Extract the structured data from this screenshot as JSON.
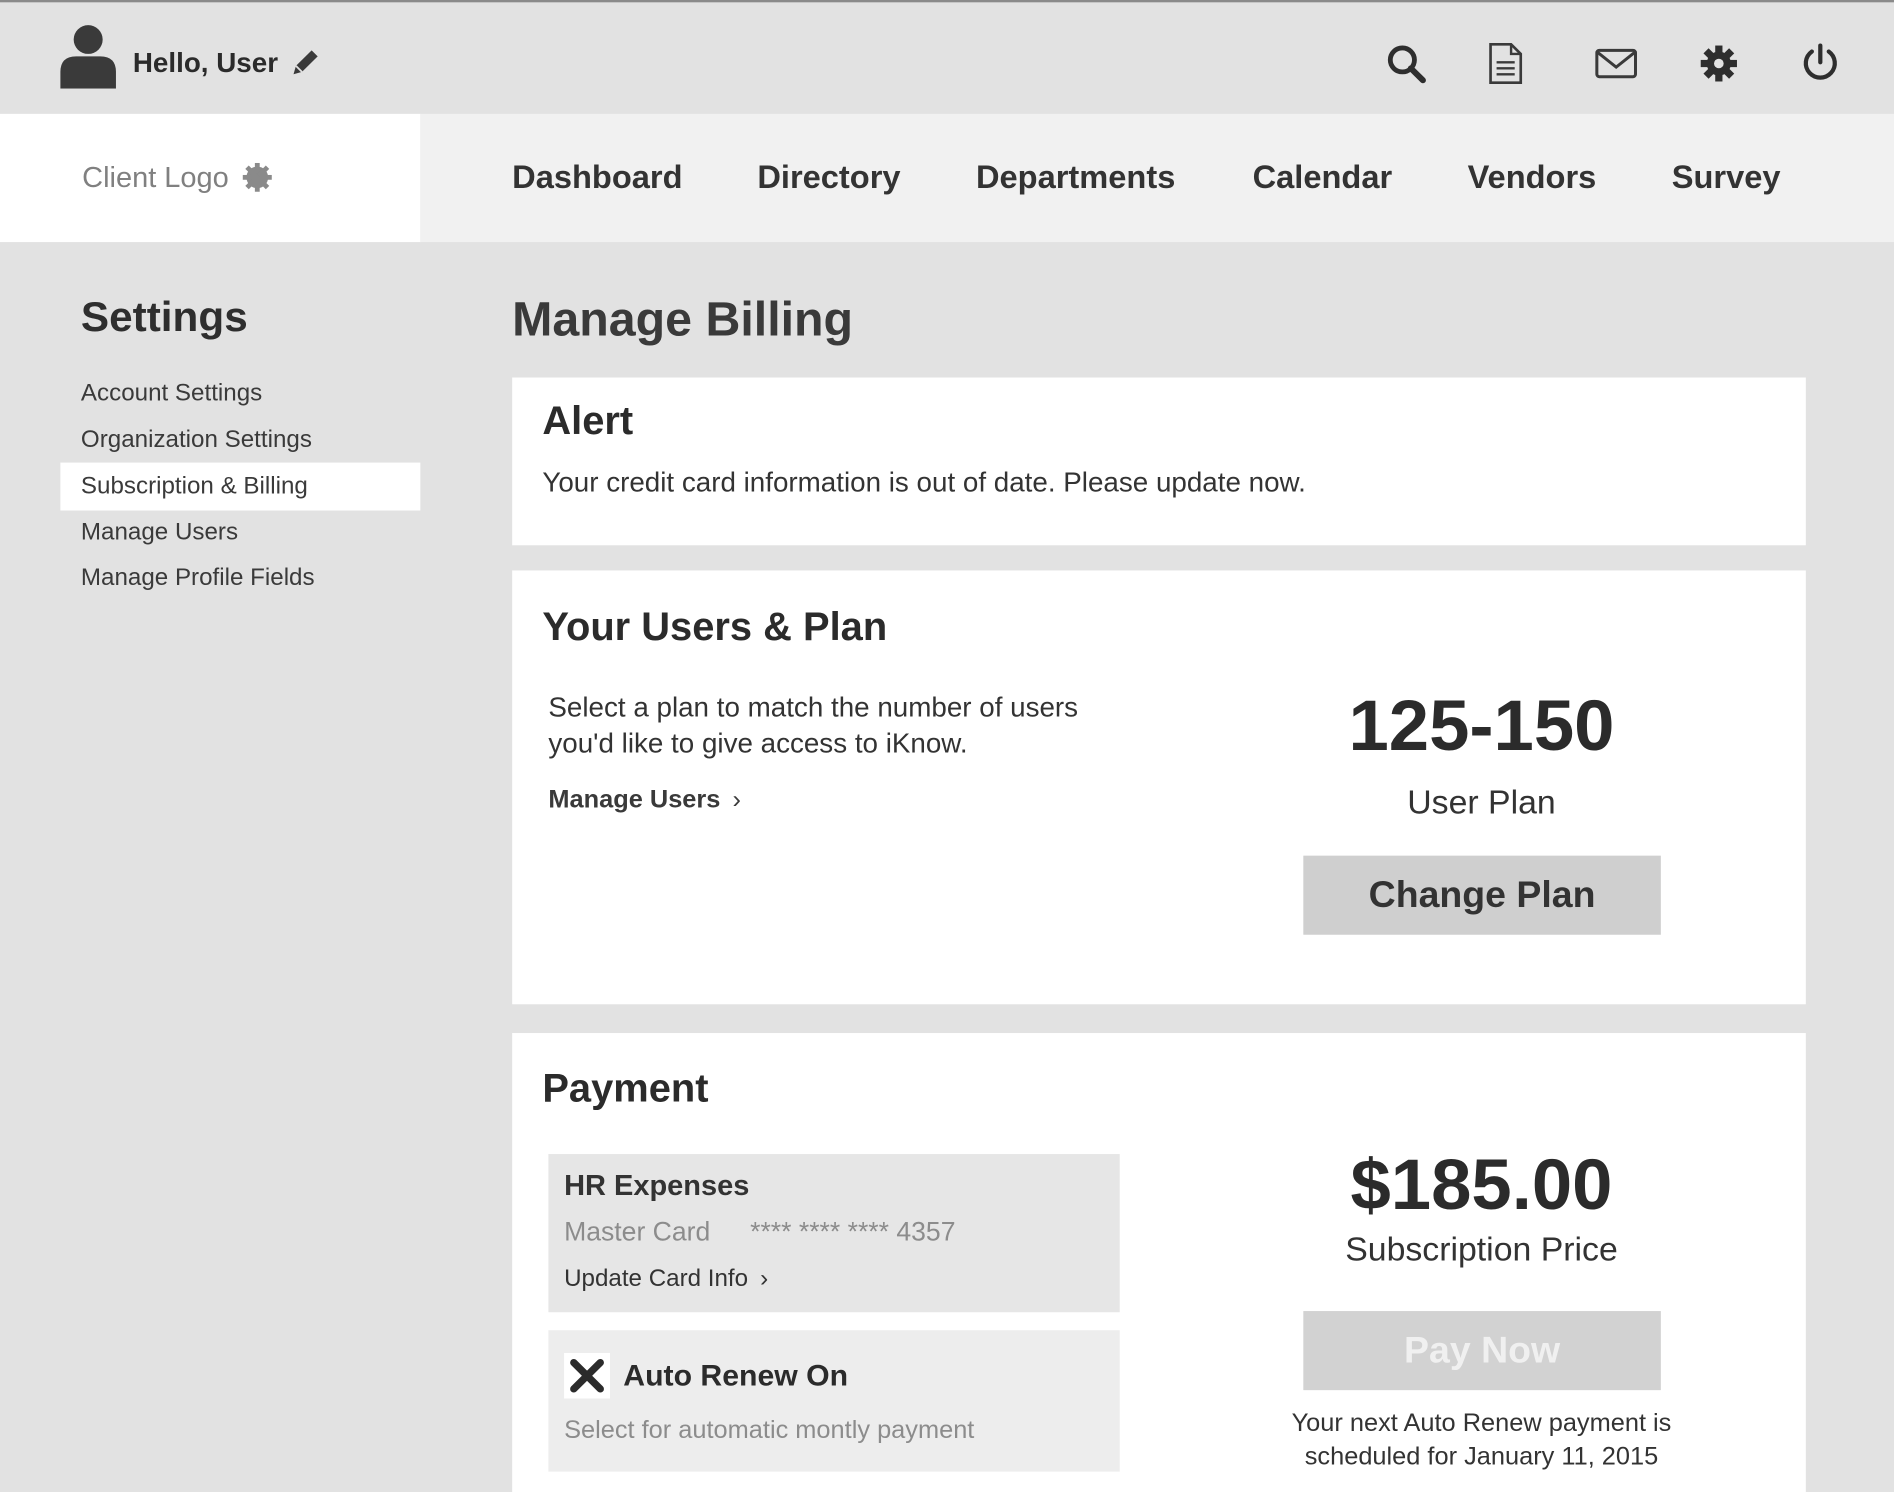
{
  "header": {
    "greeting": "Hello, User",
    "icons": [
      "user-icon",
      "pencil-icon",
      "search-icon",
      "document-icon",
      "mail-icon",
      "gear-icon",
      "power-icon"
    ]
  },
  "logo": {
    "text": "Client Logo",
    "icon": "logo-badge-icon"
  },
  "nav": {
    "items": [
      "Dashboard",
      "Directory",
      "Departments",
      "Calendar",
      "Vendors",
      "Survey"
    ]
  },
  "sidebar": {
    "title": "Settings",
    "items": [
      "Account Settings",
      "Organization Settings",
      "Subscription & Billing",
      "Manage Users",
      "Manage Profile Fields"
    ],
    "active": "Subscription & Billing"
  },
  "main": {
    "title": "Manage Billing",
    "alert": {
      "title": "Alert",
      "message": "Your credit card information is out of date. Please update now."
    },
    "plan": {
      "title": "Your Users & Plan",
      "description": "Select a plan to match the number of users you'd like to give access to iKnow.",
      "manage_link": "Manage Users",
      "range": "125-150",
      "range_label": "User Plan",
      "button": "Change Plan"
    },
    "payment": {
      "title": "Payment",
      "card_name": "HR Expenses",
      "card_type": "Master Card",
      "card_number": "**** **** **** 4357",
      "update_link": "Update Card Info",
      "auto_renew_label": "Auto Renew On",
      "auto_renew_desc": "Select for automatic montly payment",
      "auto_renew_checked": true,
      "price": "$185.00",
      "price_label": "Subscription Price",
      "button": "Pay Now",
      "note": "Your next Auto Renew payment is scheduled for January 11, 2015"
    }
  },
  "colors": {
    "background": "#e2e2e2",
    "nav_background": "#f1f1f1",
    "card_background": "#ffffff",
    "button": "#cfcfcf",
    "text": "#2b2b2b"
  }
}
